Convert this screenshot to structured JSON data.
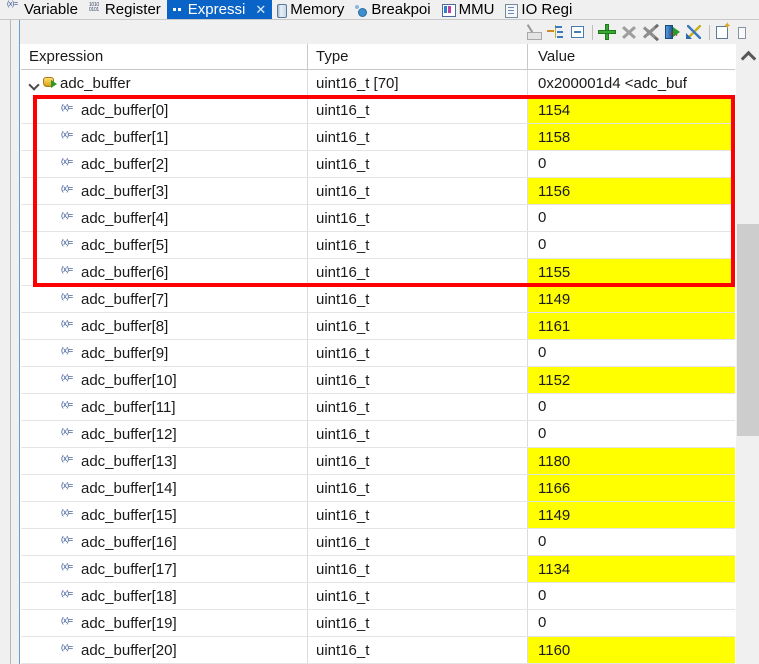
{
  "window": {
    "view_title": "Expressions"
  },
  "tabs": [
    {
      "label": "Variable",
      "icon": "variable-icon",
      "active": false,
      "closable": false
    },
    {
      "label": "Register",
      "icon": "register-icon",
      "active": false,
      "closable": false
    },
    {
      "label": "Expressi",
      "icon": "expressions-icon",
      "active": true,
      "closable": true,
      "close_glyph": "✕"
    },
    {
      "label": "Memory",
      "icon": "memory-icon",
      "active": false,
      "closable": false
    },
    {
      "label": "Breakpoi",
      "icon": "breakpoints-icon",
      "active": false,
      "closable": false
    },
    {
      "label": "MMU",
      "icon": "mmu-icon",
      "active": false,
      "closable": false
    },
    {
      "label": "IO Regi",
      "icon": "io-registers-icon",
      "active": false,
      "closable": false
    }
  ],
  "toolbar": {
    "buttons": [
      {
        "name": "force-evaluate-button",
        "icon": "force-evaluate-icon",
        "enabled": false
      },
      {
        "name": "expand-all-button",
        "icon": "expand-all-icon",
        "enabled": true
      },
      {
        "name": "collapse-all-button",
        "icon": "collapse-all-icon",
        "enabled": true
      },
      {
        "name": "add-expression-button",
        "icon": "green-plus-icon",
        "enabled": true
      },
      {
        "name": "remove-expression-button",
        "icon": "remove-x-icon",
        "enabled": false
      },
      {
        "name": "remove-all-button",
        "icon": "remove-all-x-icon",
        "enabled": false
      },
      {
        "name": "realtime-refresh-button",
        "icon": "realtime-rt-icon",
        "enabled": true
      },
      {
        "name": "refresh-button",
        "icon": "refresh-arrows-icon",
        "enabled": true
      },
      {
        "name": "new-watchpoint-button",
        "icon": "new-watchpoint-icon",
        "enabled": true
      },
      {
        "name": "view-menu-button",
        "icon": "view-menu-icon",
        "enabled": true
      }
    ]
  },
  "table": {
    "columns": [
      "Expression",
      "Type",
      "Value"
    ],
    "root": {
      "expression": "adc_buffer",
      "type": "uint16_t [70]",
      "value": "0x200001d4 <adc_buf",
      "expanded": true,
      "icon": "variable-pointer-icon",
      "highlighted": false
    },
    "rows": [
      {
        "expression": "adc_buffer[0]",
        "type": "uint16_t",
        "value": "1154",
        "highlighted": true
      },
      {
        "expression": "adc_buffer[1]",
        "type": "uint16_t",
        "value": "1158",
        "highlighted": true
      },
      {
        "expression": "adc_buffer[2]",
        "type": "uint16_t",
        "value": "0",
        "highlighted": false
      },
      {
        "expression": "adc_buffer[3]",
        "type": "uint16_t",
        "value": "1156",
        "highlighted": true
      },
      {
        "expression": "adc_buffer[4]",
        "type": "uint16_t",
        "value": "0",
        "highlighted": false
      },
      {
        "expression": "adc_buffer[5]",
        "type": "uint16_t",
        "value": "0",
        "highlighted": false
      },
      {
        "expression": "adc_buffer[6]",
        "type": "uint16_t",
        "value": "1155",
        "highlighted": true
      },
      {
        "expression": "adc_buffer[7]",
        "type": "uint16_t",
        "value": "1149",
        "highlighted": true
      },
      {
        "expression": "adc_buffer[8]",
        "type": "uint16_t",
        "value": "1161",
        "highlighted": true
      },
      {
        "expression": "adc_buffer[9]",
        "type": "uint16_t",
        "value": "0",
        "highlighted": false
      },
      {
        "expression": "adc_buffer[10]",
        "type": "uint16_t",
        "value": "1152",
        "highlighted": true
      },
      {
        "expression": "adc_buffer[11]",
        "type": "uint16_t",
        "value": "0",
        "highlighted": false
      },
      {
        "expression": "adc_buffer[12]",
        "type": "uint16_t",
        "value": "0",
        "highlighted": false
      },
      {
        "expression": "adc_buffer[13]",
        "type": "uint16_t",
        "value": "1180",
        "highlighted": true
      },
      {
        "expression": "adc_buffer[14]",
        "type": "uint16_t",
        "value": "1166",
        "highlighted": true
      },
      {
        "expression": "adc_buffer[15]",
        "type": "uint16_t",
        "value": "1149",
        "highlighted": true
      },
      {
        "expression": "adc_buffer[16]",
        "type": "uint16_t",
        "value": "0",
        "highlighted": false
      },
      {
        "expression": "adc_buffer[17]",
        "type": "uint16_t",
        "value": "1134",
        "highlighted": true
      },
      {
        "expression": "adc_buffer[18]",
        "type": "uint16_t",
        "value": "0",
        "highlighted": false
      },
      {
        "expression": "adc_buffer[19]",
        "type": "uint16_t",
        "value": "0",
        "highlighted": false
      },
      {
        "expression": "adc_buffer[20]",
        "type": "uint16_t",
        "value": "1160",
        "highlighted": true
      }
    ]
  },
  "annotation": {
    "type": "rectangle",
    "color": "#ff0000",
    "covers_rows": [
      "adc_buffer[0]",
      "adc_buffer[6]"
    ]
  },
  "colors": {
    "active_tab": "#0a64c8",
    "highlight": "#ffff00",
    "annotation": "#ff0000",
    "chrome": "#f0f0f0"
  },
  "scrollbar": {
    "orientation": "vertical",
    "up_arrow_glyph": "∧"
  }
}
